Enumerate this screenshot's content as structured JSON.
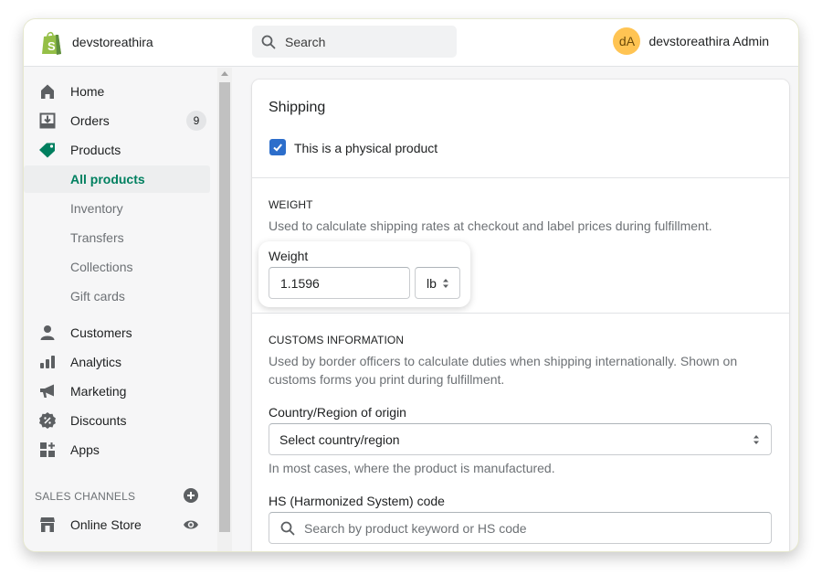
{
  "topbar": {
    "store_name": "devstoreathira",
    "search_placeholder": "Search",
    "user_initials": "dA",
    "user_name": "devstoreathira Admin",
    "avatar_color": "#ffc453"
  },
  "sidebar": {
    "items": [
      {
        "label": "Home",
        "icon": "home-icon"
      },
      {
        "label": "Orders",
        "icon": "orders-icon",
        "badge": "9"
      },
      {
        "label": "Products",
        "icon": "products-tag-icon"
      },
      {
        "label": "All products",
        "active": true
      },
      {
        "label": "Inventory"
      },
      {
        "label": "Transfers"
      },
      {
        "label": "Collections"
      },
      {
        "label": "Gift cards"
      },
      {
        "label": "Customers",
        "icon": "customers-icon"
      },
      {
        "label": "Analytics",
        "icon": "analytics-icon"
      },
      {
        "label": "Marketing",
        "icon": "marketing-icon"
      },
      {
        "label": "Discounts",
        "icon": "discounts-icon"
      },
      {
        "label": "Apps",
        "icon": "apps-icon"
      }
    ],
    "sales_channels_title": "SALES CHANNELS",
    "channels": [
      {
        "label": "Online Store",
        "icon": "online-store-icon"
      }
    ],
    "accent_color": "#008060"
  },
  "shipping": {
    "title": "Shipping",
    "physical_product_label": "This is a physical product",
    "physical_product_checked": true,
    "weight_section": {
      "heading": "WEIGHT",
      "help": "Used to calculate shipping rates at checkout and label prices during fulfillment.",
      "field_label": "Weight",
      "value": "1.1596",
      "unit": "lb"
    },
    "customs_section": {
      "heading": "CUSTOMS INFORMATION",
      "help": "Used by border officers to calculate duties when shipping internationally. Shown on customs forms you print during fulfillment.",
      "country_label": "Country/Region of origin",
      "country_value": "Select country/region",
      "country_help": "In most cases, where the product is manufactured.",
      "hs_label": "HS (Harmonized System) code",
      "hs_placeholder": "Search by product keyword or HS code"
    }
  }
}
